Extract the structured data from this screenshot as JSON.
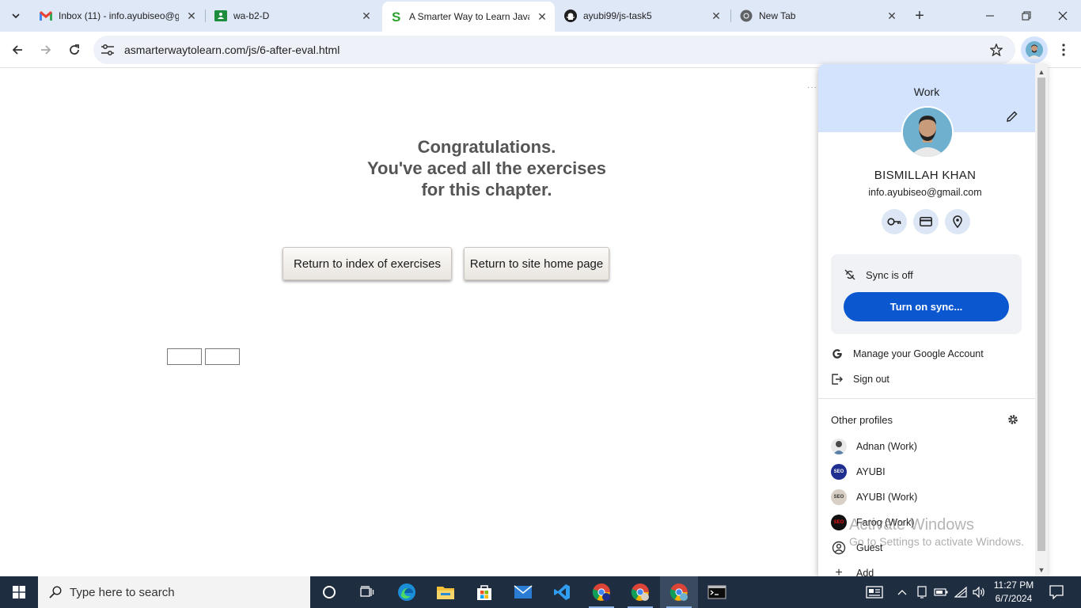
{
  "tabs": [
    {
      "title": "Inbox (11) - info.ayubiseo@g",
      "icon": "gmail-icon"
    },
    {
      "title": "wa-b2-D",
      "icon": "classroom-icon"
    },
    {
      "title": "A Smarter Way to Learn Java",
      "icon": "asmarterway-icon"
    },
    {
      "title": "ayubi99/js-task5",
      "icon": "github-icon"
    },
    {
      "title": "New Tab",
      "icon": "chrome-icon"
    }
  ],
  "address_bar": {
    "url": "asmarterwaytolearn.com/js/6-after-eval.html"
  },
  "page": {
    "congrats_line1": "Congratulations.",
    "congrats_line2": "You've aced all the exercises",
    "congrats_line3": "for this chapter.",
    "btn_index": "Return to index of exercises",
    "btn_home": "Return to site home page"
  },
  "profile_panel": {
    "label": "Work",
    "name": "BISMILLAH KHAN",
    "email": "info.ayubiseo@gmail.com",
    "sync_status": "Sync is off",
    "sync_button": "Turn on sync...",
    "manage_account": "Manage your Google Account",
    "sign_out": "Sign out",
    "other_profiles_title": "Other profiles",
    "profiles": [
      {
        "name": "Adnan (Work)"
      },
      {
        "name": "AYUBI"
      },
      {
        "name": "AYUBI (Work)"
      },
      {
        "name": "Faroq (Work)"
      },
      {
        "name": "Guest"
      },
      {
        "name": "Add"
      }
    ]
  },
  "watermark": {
    "line1": "Activate Windows",
    "line2": "Go to Settings to activate Windows."
  },
  "taskbar": {
    "search_placeholder": "Type here to search",
    "time": "11:27 PM",
    "date": "6/7/2024"
  },
  "colors": {
    "accent": "#0b57d0",
    "tabstrip": "#dfe8f7",
    "taskbar": "#1f2d40"
  }
}
